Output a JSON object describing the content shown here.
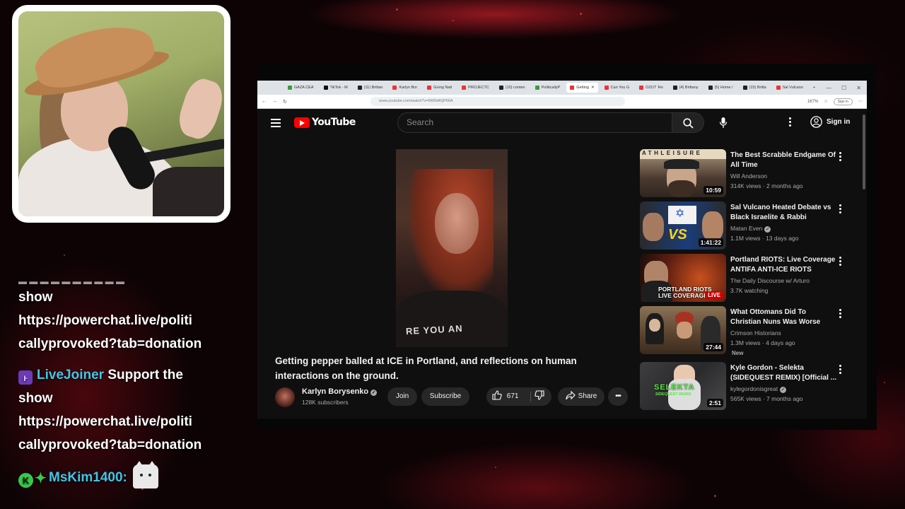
{
  "chat": {
    "messages": [
      {
        "user": "",
        "lines": [
          "show",
          "https://powerchat.live/politi",
          "callyprovoked?tab=donation"
        ]
      },
      {
        "user": "LiveJoiner",
        "text_first": "Support the",
        "lines": [
          "show",
          "https://powerchat.live/politi",
          "callyprovoked?tab=donation"
        ]
      },
      {
        "user": "MsKim1400:",
        "emote": "cat-emote"
      }
    ]
  },
  "browser": {
    "tabs": [
      "GAZA CEA",
      "TikTok - M",
      "(11) Brittan",
      "Karlyn Bor",
      "Going Nati",
      "PROJECTC",
      "(10) conten",
      "PoliticallyP",
      "Getting",
      "Can You G",
      "OZUT 'Ho",
      "(4) Brittany",
      "(5) Home /",
      "(15) Britta",
      "Sal Vulcano"
    ],
    "active_tab": 8,
    "url": "www.youtube.com/watch?v=9W9d4QP66A",
    "zoom": "167%",
    "signin_mini": "Sign in"
  },
  "youtube": {
    "logo": "YouTube",
    "search_placeholder": "Search",
    "signin": "Sign in",
    "video": {
      "title": "Getting pepper balled at ICE in Portland, and reflections on human interactions on the ground.",
      "shirt_text": "RE YOU AN",
      "channel": "Karlyn Borysenko",
      "subscribers": "128K subscribers",
      "join": "Join",
      "subscribe": "Subscribe",
      "likes": "671",
      "share": "Share"
    },
    "recommendations": [
      {
        "title": "The Best Scrabble Endgame Of All Time",
        "channel": "Will Anderson",
        "meta": "314K views · 2 months ago",
        "duration": "10:59",
        "verified": false
      },
      {
        "title": "Sal Vulcano Heated Debate vs Black Israelite & Rabbi",
        "channel": "Matan Even",
        "meta": "1.1M views · 13 days ago",
        "duration": "1:41:22",
        "verified": true
      },
      {
        "title": "Portland RIOTS: Live Coverage ANTIFA ANTI-ICE RIOTS",
        "channel": "The Daily Discourse w/ Arturo",
        "meta": "3.7K watching",
        "live": "LIVE",
        "verified": false
      },
      {
        "title": "What Ottomans Did To Christian Nuns Was Worse Than You ...",
        "channel": "Crimson Historians",
        "meta": "1.3M views · 4 days ago",
        "duration": "27:44",
        "badge": "New",
        "verified": false
      },
      {
        "title": "Kyle Gordon - Selekta (SIDEQUEST REMIX) [Official ...",
        "channel": "kylegordonisgreat",
        "meta": "565K views · 7 months ago",
        "duration": "2:51",
        "verified": true
      }
    ],
    "thumb_texts": {
      "scrabble": "ATHLEISURE",
      "vs": "VS",
      "portland": "PORTLAND RIOTS LIVE COVERAGE",
      "selekta": "SELEKTA",
      "selekta_sub": "SIDEQUEST REMIX"
    }
  },
  "colors": {
    "yt_red": "#ff0000",
    "chat_user": "#41c6e6",
    "live_red": "#cc0000"
  }
}
